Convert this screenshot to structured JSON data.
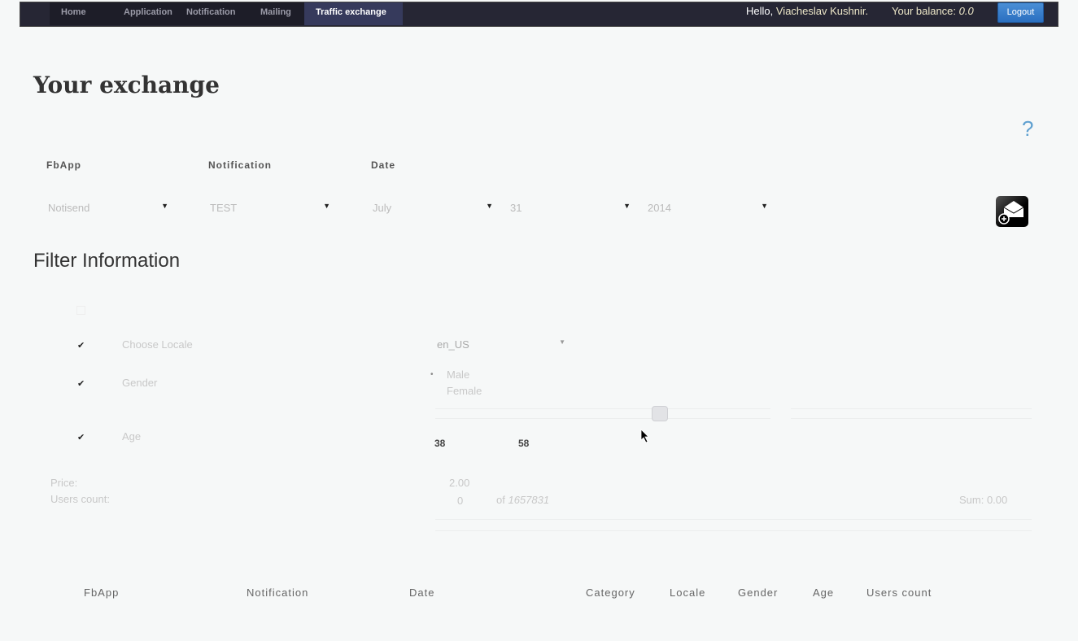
{
  "nav": {
    "items": [
      "Home",
      "Application",
      "Notification",
      "Mailing",
      "Traffic exchange"
    ],
    "active": 4,
    "hello": "Hello,",
    "user": "Viacheslav Kushnir.",
    "balance_label": "Your balance:",
    "balance": "0.0",
    "logout": "Logout"
  },
  "page": {
    "title": "Your exchange",
    "help": "?"
  },
  "form": {
    "fbapp_label": "FbApp",
    "notification_label": "Notification",
    "date_label": "Date",
    "fbapp": "Notisend",
    "notification": "TEST",
    "month": "July",
    "day": "31",
    "year": "2014"
  },
  "filter": {
    "title": "Filter Information",
    "rows": [
      {
        "label": "Choose Locale",
        "checked": true
      },
      {
        "label": "Gender",
        "checked": true
      },
      {
        "label": "Age",
        "checked": true
      }
    ],
    "locale": "en_US",
    "genders": [
      "Male",
      "Female"
    ],
    "age_min": "38",
    "age_max": "58",
    "price_label": "Price:",
    "price": "2.00",
    "users_label": "Users count:",
    "users": "0",
    "of": "of",
    "total": "1657831",
    "sum": "Sum: 0.00"
  },
  "table": {
    "headers": [
      "FbApp",
      "Notification",
      "Date",
      "Category",
      "Locale",
      "Gender",
      "Age",
      "Users count"
    ]
  }
}
